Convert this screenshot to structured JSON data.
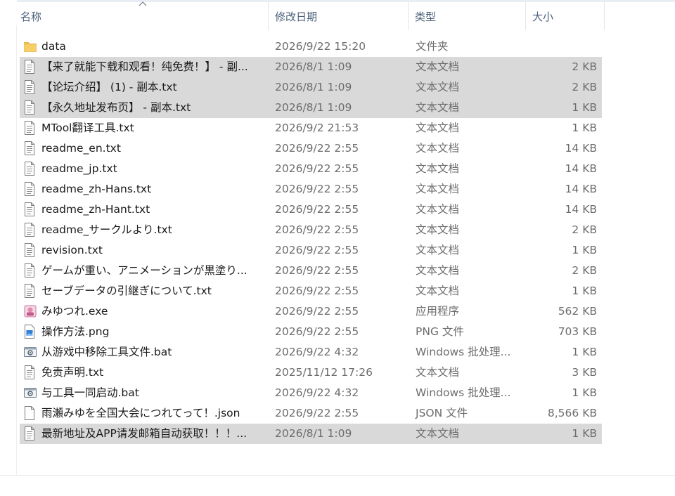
{
  "columns": {
    "name": "名称",
    "date": "修改日期",
    "type": "类型",
    "size": "大小"
  },
  "sort_icon": "sort-ascending-arrow",
  "files": [
    {
      "icon": "folder-icon",
      "name": "data",
      "date": "2026/9/22 15:20",
      "type": "文件夹",
      "size": "",
      "selected": false
    },
    {
      "icon": "text-file-icon",
      "name": "【来了就能下载和观看！纯免费！】 - 副...",
      "date": "2026/8/1 1:09",
      "type": "文本文档",
      "size": "2 KB",
      "selected": true
    },
    {
      "icon": "text-file-icon",
      "name": "【论坛介绍】 (1) - 副本.txt",
      "date": "2026/8/1 1:09",
      "type": "文本文档",
      "size": "2 KB",
      "selected": true
    },
    {
      "icon": "text-file-icon",
      "name": "【永久地址发布页】 - 副本.txt",
      "date": "2026/8/1 1:09",
      "type": "文本文档",
      "size": "1 KB",
      "selected": true
    },
    {
      "icon": "text-file-icon",
      "name": "MTool翻译工具.txt",
      "date": "2026/9/2 21:53",
      "type": "文本文档",
      "size": "1 KB",
      "selected": false
    },
    {
      "icon": "text-file-icon",
      "name": "readme_en.txt",
      "date": "2026/9/22 2:55",
      "type": "文本文档",
      "size": "14 KB",
      "selected": false
    },
    {
      "icon": "text-file-icon",
      "name": "readme_jp.txt",
      "date": "2026/9/22 2:55",
      "type": "文本文档",
      "size": "14 KB",
      "selected": false
    },
    {
      "icon": "text-file-icon",
      "name": "readme_zh-Hans.txt",
      "date": "2026/9/22 2:55",
      "type": "文本文档",
      "size": "14 KB",
      "selected": false
    },
    {
      "icon": "text-file-icon",
      "name": "readme_zh-Hant.txt",
      "date": "2026/9/22 2:55",
      "type": "文本文档",
      "size": "14 KB",
      "selected": false
    },
    {
      "icon": "text-file-icon",
      "name": "readme_サークルより.txt",
      "date": "2026/9/22 2:55",
      "type": "文本文档",
      "size": "2 KB",
      "selected": false
    },
    {
      "icon": "text-file-icon",
      "name": "revision.txt",
      "date": "2026/9/22 2:55",
      "type": "文本文档",
      "size": "1 KB",
      "selected": false
    },
    {
      "icon": "text-file-icon",
      "name": "ゲームが重い、アニメーションが黒塗り...",
      "date": "2026/9/22 2:55",
      "type": "文本文档",
      "size": "2 KB",
      "selected": false
    },
    {
      "icon": "text-file-icon",
      "name": "セーブデータの引継ぎについて.txt",
      "date": "2026/9/22 2:55",
      "type": "文本文档",
      "size": "1 KB",
      "selected": false
    },
    {
      "icon": "app-exe-icon",
      "name": "みゆつれ.exe",
      "date": "2026/9/22 2:55",
      "type": "应用程序",
      "size": "562 KB",
      "selected": false
    },
    {
      "icon": "image-file-icon",
      "name": "操作方法.png",
      "date": "2026/9/22 2:55",
      "type": "PNG 文件",
      "size": "703 KB",
      "selected": false
    },
    {
      "icon": "batch-file-icon",
      "name": "从游戏中移除工具文件.bat",
      "date": "2026/9/22 4:32",
      "type": "Windows 批处理...",
      "size": "1 KB",
      "selected": false
    },
    {
      "icon": "text-file-icon",
      "name": "免责声明.txt",
      "date": "2025/11/12 17:26",
      "type": "文本文档",
      "size": "3 KB",
      "selected": false
    },
    {
      "icon": "batch-file-icon",
      "name": "与工具一同启动.bat",
      "date": "2026/9/22 4:32",
      "type": "Windows 批处理...",
      "size": "1 KB",
      "selected": false
    },
    {
      "icon": "blank-file-icon",
      "name": "雨瀬みゆを全国大会につれてって！.json",
      "date": "2026/9/22 2:55",
      "type": "JSON 文件",
      "size": "8,566 KB",
      "selected": false
    },
    {
      "icon": "text-file-icon",
      "name": "最新地址及APP请发邮箱自动获取！！！...",
      "date": "2026/8/1 1:09",
      "type": "文本文档",
      "size": "1 KB",
      "selected": true
    }
  ],
  "colors": {
    "header_text": "#4c607a",
    "row_selected": "#d9d9d9",
    "meta_text": "#6d6d6d",
    "folder": "#f2c14e"
  }
}
